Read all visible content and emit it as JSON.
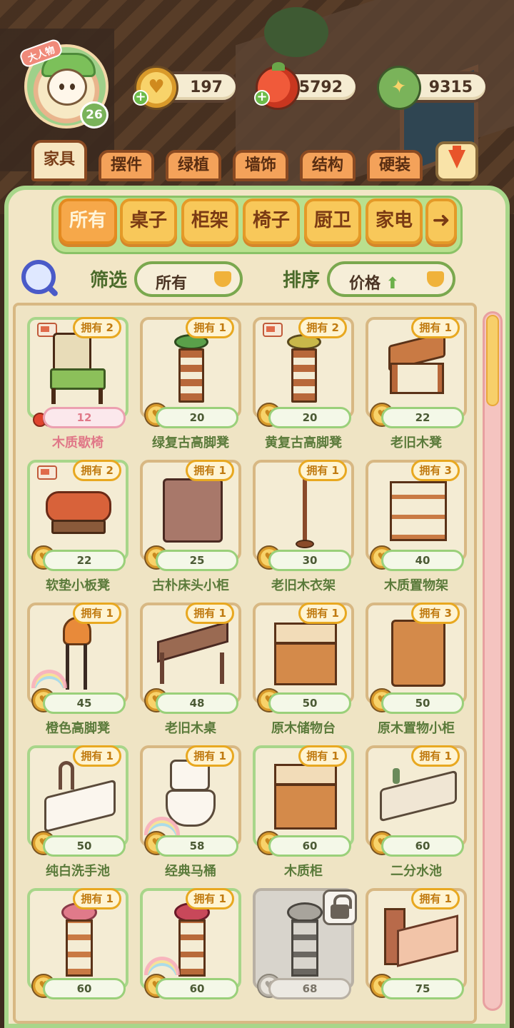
{
  "header": {
    "avatar_tag": "大人物",
    "level": "26",
    "currencies": [
      {
        "icon": "gold-coin-icon",
        "value": "197"
      },
      {
        "icon": "tomato-icon",
        "value": "5792"
      },
      {
        "icon": "book-icon",
        "value": "9315"
      }
    ]
  },
  "main_tabs": [
    "家具",
    "摆件",
    "绿植",
    "墙饰",
    "结构",
    "硬装"
  ],
  "sub_categories": [
    "所有",
    "桌子",
    "柜架",
    "椅子",
    "厨卫",
    "家电"
  ],
  "filter": {
    "filter_label": "筛选",
    "filter_value": "所有",
    "sort_label": "排序",
    "sort_value": "价格"
  },
  "items": [
    {
      "owned": "拥有 2",
      "price": "12",
      "name": "木质歇椅",
      "currency": "cherry",
      "delivery": true
    },
    {
      "owned": "拥有 1",
      "price": "20",
      "name": "绿复古高脚凳"
    },
    {
      "owned": "拥有 2",
      "price": "20",
      "name": "黄复古高脚凳",
      "delivery": true
    },
    {
      "owned": "拥有 1",
      "price": "22",
      "name": "老旧木凳"
    },
    {
      "owned": "拥有 2",
      "price": "22",
      "name": "软垫小板凳",
      "delivery": true
    },
    {
      "owned": "拥有 1",
      "price": "25",
      "name": "古朴床头小柜"
    },
    {
      "owned": "拥有 1",
      "price": "30",
      "name": "老旧木衣架"
    },
    {
      "owned": "拥有 3",
      "price": "40",
      "name": "木质置物架"
    },
    {
      "owned": "拥有 1",
      "price": "45",
      "name": "橙色高脚凳"
    },
    {
      "owned": "拥有 1",
      "price": "48",
      "name": "老旧木桌"
    },
    {
      "owned": "拥有 1",
      "price": "50",
      "name": "原木储物台"
    },
    {
      "owned": "拥有 3",
      "price": "50",
      "name": "原木置物小柜"
    },
    {
      "owned": "拥有 1",
      "price": "50",
      "name": "纯白洗手池"
    },
    {
      "owned": "拥有 1",
      "price": "58",
      "name": "经典马桶"
    },
    {
      "owned": "拥有 1",
      "price": "60",
      "name": "木质柜"
    },
    {
      "owned": "拥有 1",
      "price": "60",
      "name": "二分水池"
    },
    {
      "owned": "拥有 1",
      "price": "60",
      "name": ""
    },
    {
      "owned": "拥有 1",
      "price": "60",
      "name": ""
    },
    {
      "owned": "",
      "price": "68",
      "name": "",
      "locked": true
    },
    {
      "owned": "拥有 1",
      "price": "75",
      "name": ""
    }
  ]
}
